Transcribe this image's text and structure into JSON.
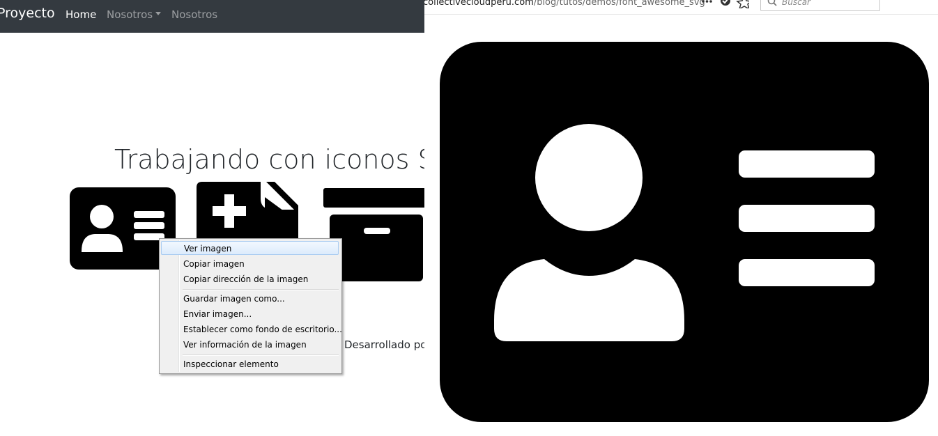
{
  "navbar": {
    "brand": "Proyecto",
    "items": [
      {
        "label": "Home",
        "active": true
      },
      {
        "label": "Nosotros",
        "dropdown": true
      },
      {
        "label": "Nosotros"
      }
    ]
  },
  "page": {
    "heading": "Trabajando con iconos SV",
    "footer": "Desarrollado po"
  },
  "browser": {
    "url_domain": "collectivecloudperu.com",
    "url_path": "/blog/tutos/demos/font_awesome_svg",
    "search_placeholder": "Buscar"
  },
  "context_menu": {
    "items": [
      {
        "label": "Ver imagen",
        "highlighted": true
      },
      {
        "label": "Copiar imagen"
      },
      {
        "label": "Copiar dirección de la imagen"
      },
      {
        "label": "Guardar imagen como..."
      },
      {
        "label": "Enviar imagen..."
      },
      {
        "label": "Establecer como fondo de escritorio..."
      },
      {
        "label": "Ver información de la imagen"
      },
      {
        "label": "Inspeccionar elemento"
      }
    ]
  },
  "icons": {
    "left": [
      "id-card-icon",
      "file-medical-icon",
      "archive-box-icon"
    ],
    "right": "id-card-icon",
    "colors": {
      "icon": "#000000",
      "navbar": "#343a40"
    }
  }
}
